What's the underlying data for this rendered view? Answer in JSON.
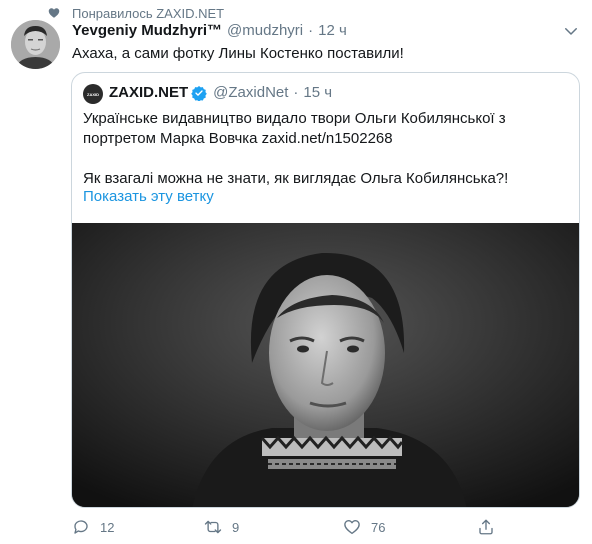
{
  "context": {
    "text": "Понравилось ZAXID.NET",
    "icon": "heart-icon"
  },
  "tweet": {
    "author_name": "Yevgeniy Mudzhyri™",
    "author_handle": "@mudzhyri",
    "separator": "·",
    "time": "12 ч",
    "text": "Ахаха, а сами фотку Лины Костенко поставили!"
  },
  "quote": {
    "avatar_label": "ZAXID",
    "name": "ZAXID.NET",
    "handle": "@ZaxidNet",
    "separator": "·",
    "time": "15 ч",
    "lines": [
      "Українське видавництво видало твори Ольги Кобилянської з",
      "портретом Марка Вовчка zaxid.net/n1502268",
      "Як взагалі можна не знати, як виглядає Ольга Кобилянська?!"
    ],
    "show_thread": "Показать эту ветку"
  },
  "actions": {
    "reply": "12",
    "retweet": "9",
    "like": "76",
    "reply_icon": "reply-icon",
    "retweet_icon": "retweet-icon",
    "like_icon": "like-icon",
    "share_icon": "share-icon"
  },
  "colors": {
    "link": "#1b95e0",
    "secondary_text": "#657786",
    "border": "#ccd6dd",
    "verified": "#1da1f2"
  }
}
